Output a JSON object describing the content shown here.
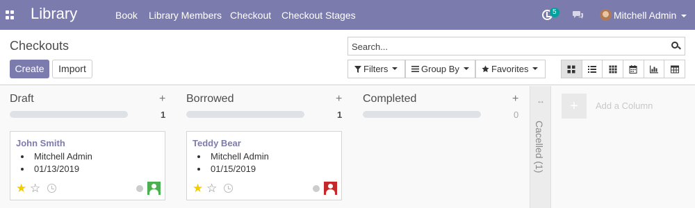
{
  "navbar": {
    "brand": "Library",
    "menus": [
      "Book",
      "Library Members",
      "Checkout",
      "Checkout Stages"
    ],
    "activity_badge": "5",
    "user_name": "Mitchell Admin",
    "bg_color": "#7c7bad"
  },
  "control": {
    "title": "Checkouts",
    "create_label": "Create",
    "import_label": "Import",
    "search_placeholder": "Search...",
    "filters_label": "Filters",
    "groupby_label": "Group By",
    "favorites_label": "Favorites",
    "views": [
      "kanban-icon",
      "list-icon",
      "grid-icon",
      "calendar-icon",
      "graph-icon",
      "pivot-icon"
    ],
    "active_view": "kanban"
  },
  "kanban": {
    "columns": [
      {
        "title": "Draft",
        "count": "1",
        "cards": [
          {
            "name": "John Smith",
            "user": "Mitchell Admin",
            "date": "01/13/2019",
            "avatar_color": "#4caf50",
            "starred": true
          }
        ]
      },
      {
        "title": "Borrowed",
        "count": "1",
        "cards": [
          {
            "name": "Teddy Bear",
            "user": "Mitchell Admin",
            "date": "01/15/2019",
            "avatar_color": "#c62828",
            "starred": true
          }
        ]
      },
      {
        "title": "Completed",
        "count": "0",
        "cards": []
      }
    ],
    "folded_column": "Cacelled (1)",
    "add_column_label": "Add a Column"
  }
}
